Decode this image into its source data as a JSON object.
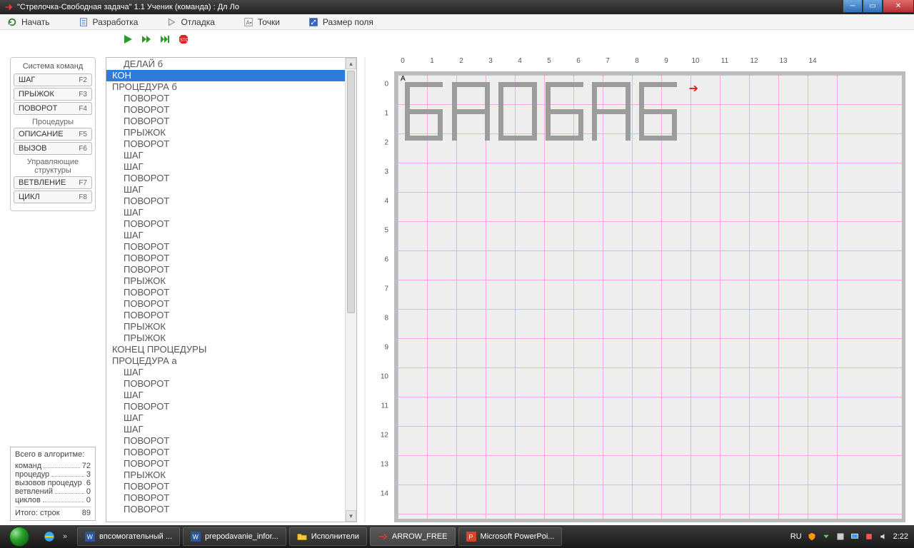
{
  "titlebar": {
    "title": "\"Стрелочка-Свободная задача\" 1.1     Ученик (команда) : Дл Ло"
  },
  "menu": {
    "items": [
      {
        "label": "Начать"
      },
      {
        "label": "Разработка"
      },
      {
        "label": "Отладка"
      },
      {
        "label": "Точки"
      },
      {
        "label": "Размер поля"
      }
    ]
  },
  "palette": {
    "group1_title": "Система команд",
    "buttons1": [
      {
        "label": "ШАГ",
        "fkey": "F2"
      },
      {
        "label": "ПРЫЖОК",
        "fkey": "F3"
      },
      {
        "label": "ПОВОРОТ",
        "fkey": "F4"
      }
    ],
    "sub1": "Процедуры",
    "buttons2": [
      {
        "label": "ОПИСАНИЕ",
        "fkey": "F5"
      },
      {
        "label": "ВЫЗОВ",
        "fkey": "F6"
      }
    ],
    "sub2": "Управляющие структуры",
    "buttons3": [
      {
        "label": "ВЕТВЛЕНИЕ",
        "fkey": "F7"
      },
      {
        "label": "ЦИКЛ",
        "fkey": "F8"
      }
    ]
  },
  "stats": {
    "title": "Всего в алгоритме:",
    "rows": [
      {
        "label": "команд",
        "val": "72"
      },
      {
        "label": "процедур",
        "val": "3"
      },
      {
        "label": "вызовов процедур",
        "val": "6"
      },
      {
        "label": "ветвлений",
        "val": "0"
      },
      {
        "label": "циклов",
        "val": "0"
      }
    ],
    "footer_label": "Итого:  строк",
    "footer_val": "89"
  },
  "code": {
    "lines": [
      {
        "text": "ДЕЛАЙ б",
        "indent": 1
      },
      {
        "text": "КОН",
        "indent": 0,
        "selected": true
      },
      {
        "text": "ПРОЦЕДУРА б",
        "indent": 0
      },
      {
        "text": "ПОВОРОТ",
        "indent": 1
      },
      {
        "text": "ПОВОРОТ",
        "indent": 1
      },
      {
        "text": "ПОВОРОТ",
        "indent": 1
      },
      {
        "text": "ПРЫЖОК",
        "indent": 1
      },
      {
        "text": "ПОВОРОТ",
        "indent": 1
      },
      {
        "text": "ШАГ",
        "indent": 1
      },
      {
        "text": "ШАГ",
        "indent": 1
      },
      {
        "text": "ПОВОРОТ",
        "indent": 1
      },
      {
        "text": "ШАГ",
        "indent": 1
      },
      {
        "text": "ПОВОРОТ",
        "indent": 1
      },
      {
        "text": "ШАГ",
        "indent": 1
      },
      {
        "text": "ПОВОРОТ",
        "indent": 1
      },
      {
        "text": "ШАГ",
        "indent": 1
      },
      {
        "text": "ПОВОРОТ",
        "indent": 1
      },
      {
        "text": "ПОВОРОТ",
        "indent": 1
      },
      {
        "text": "ПОВОРОТ",
        "indent": 1
      },
      {
        "text": "ПРЫЖОК",
        "indent": 1
      },
      {
        "text": "ПОВОРОТ",
        "indent": 1
      },
      {
        "text": "ПОВОРОТ",
        "indent": 1
      },
      {
        "text": "ПОВОРОТ",
        "indent": 1
      },
      {
        "text": "ПРЫЖОК",
        "indent": 1
      },
      {
        "text": "ПРЫЖОК",
        "indent": 1
      },
      {
        "text": "КОНЕЦ ПРОЦЕДУРЫ",
        "indent": 0
      },
      {
        "text": "ПРОЦЕДУРА a",
        "indent": 0
      },
      {
        "text": "ШАГ",
        "indent": 1
      },
      {
        "text": "ПОВОРОТ",
        "indent": 1
      },
      {
        "text": "ШАГ",
        "indent": 1
      },
      {
        "text": "ПОВОРОТ",
        "indent": 1
      },
      {
        "text": "ШАГ",
        "indent": 1
      },
      {
        "text": "ШАГ",
        "indent": 1
      },
      {
        "text": "ПОВОРОТ",
        "indent": 1
      },
      {
        "text": "ПОВОРОТ",
        "indent": 1
      },
      {
        "text": "ПОВОРОТ",
        "indent": 1
      },
      {
        "text": "ПРЫЖОК",
        "indent": 1
      },
      {
        "text": "ПОВОРОТ",
        "indent": 1
      },
      {
        "text": "ПОВОРОТ",
        "indent": 1
      },
      {
        "text": "ПОВОРОТ",
        "indent": 1
      }
    ]
  },
  "canvas": {
    "cols": 15,
    "rows": 15,
    "cell": 41,
    "label_A": "A",
    "arrow_symbol": "➔",
    "letters_text": "БАОБАБ"
  },
  "taskbar": {
    "items": [
      {
        "label": "впсомогательный ...",
        "icon": "word"
      },
      {
        "label": "prepodavanie_infor...",
        "icon": "word"
      },
      {
        "label": "Исполнители",
        "icon": "folder"
      },
      {
        "label": "ARROW_FREE",
        "icon": "arrow",
        "active": true
      },
      {
        "label": "Microsoft PowerPoi...",
        "icon": "ppt"
      }
    ],
    "lang": "RU",
    "clock": "2:22"
  }
}
